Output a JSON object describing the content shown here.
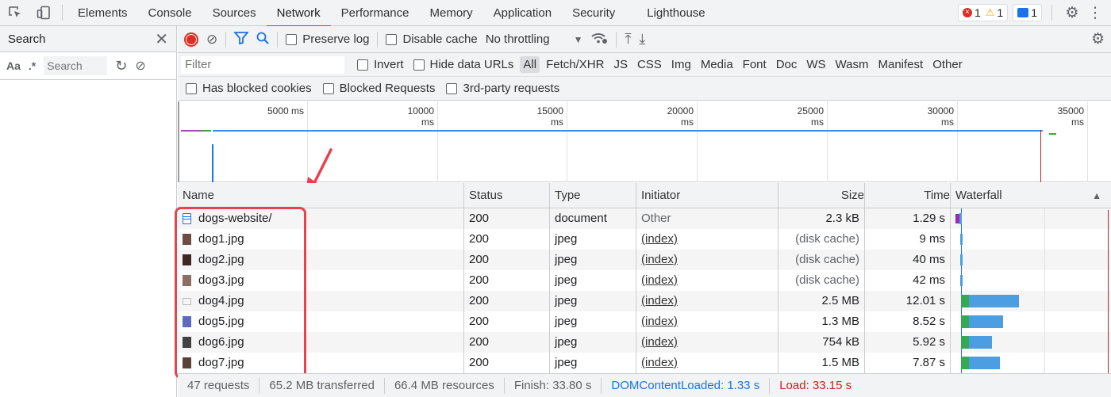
{
  "tabs": [
    "Elements",
    "Console",
    "Sources",
    "Network",
    "Performance",
    "Memory",
    "Application",
    "Security",
    "Lighthouse"
  ],
  "active_tab": "Network",
  "badges": {
    "errors": "1",
    "warnings": "1",
    "messages": "1"
  },
  "sidebar": {
    "title": "Search",
    "case_label": "Aa",
    "regex_label": ".*",
    "search_placeholder": "Search"
  },
  "toolbar": {
    "preserve_log": "Preserve log",
    "disable_cache": "Disable cache",
    "throttling": "No throttling"
  },
  "filter": {
    "placeholder": "Filter",
    "invert": "Invert",
    "hide_data_urls": "Hide data URLs",
    "types": [
      "All",
      "Fetch/XHR",
      "JS",
      "CSS",
      "Img",
      "Media",
      "Font",
      "Doc",
      "WS",
      "Wasm",
      "Manifest",
      "Other"
    ],
    "active_type": "All"
  },
  "row3": {
    "blocked_cookies": "Has blocked cookies",
    "blocked_requests": "Blocked Requests",
    "third_party": "3rd-party requests"
  },
  "overview_ticks": [
    "5000 ms",
    "10000 ms",
    "15000 ms",
    "20000 ms",
    "25000 ms",
    "30000 ms",
    "35000 ms"
  ],
  "columns": [
    "Name",
    "Status",
    "Type",
    "Initiator",
    "Size",
    "Time",
    "Waterfall"
  ],
  "rows": [
    {
      "name": "dogs-website/",
      "status": "200",
      "type": "document",
      "initiator": "Other",
      "size": "2.3 kB",
      "time": "1.29 s",
      "icon": "document-icon",
      "wf_start": 0.02,
      "wf_len": 0.015
    },
    {
      "name": "dog1.jpg",
      "status": "200",
      "type": "jpeg",
      "initiator": "(index)",
      "size": "(disk cache)",
      "time": "9 ms",
      "icon": "image-icon",
      "wf_start": 0.06,
      "wf_len": 0.01
    },
    {
      "name": "dog2.jpg",
      "status": "200",
      "type": "jpeg",
      "initiator": "(index)",
      "size": "(disk cache)",
      "time": "40 ms",
      "icon": "image-icon",
      "wf_start": 0.06,
      "wf_len": 0.01
    },
    {
      "name": "dog3.jpg",
      "status": "200",
      "type": "jpeg",
      "initiator": "(index)",
      "size": "(disk cache)",
      "time": "42 ms",
      "icon": "image-icon",
      "wf_start": 0.06,
      "wf_len": 0.01
    },
    {
      "name": "dog4.jpg",
      "status": "200",
      "type": "jpeg",
      "initiator": "(index)",
      "size": "2.5 MB",
      "time": "12.01 s",
      "icon": "image-icon",
      "wf_start": 0.065,
      "wf_len": 0.36
    },
    {
      "name": "dog5.jpg",
      "status": "200",
      "type": "jpeg",
      "initiator": "(index)",
      "size": "1.3 MB",
      "time": "8.52 s",
      "icon": "image-icon",
      "wf_start": 0.065,
      "wf_len": 0.26
    },
    {
      "name": "dog6.jpg",
      "status": "200",
      "type": "jpeg",
      "initiator": "(index)",
      "size": "754 kB",
      "time": "5.92 s",
      "icon": "image-icon",
      "wf_start": 0.065,
      "wf_len": 0.19
    },
    {
      "name": "dog7.jpg",
      "status": "200",
      "type": "jpeg",
      "initiator": "(index)",
      "size": "1.5 MB",
      "time": "7.87 s",
      "icon": "image-icon",
      "wf_start": 0.065,
      "wf_len": 0.24
    }
  ],
  "statusbar": {
    "requests": "47 requests",
    "transferred": "65.2 MB transferred",
    "resources": "66.4 MB resources",
    "finish": "Finish: 33.80 s",
    "dcl": "DOMContentLoaded: 1.33 s",
    "load": "Load: 33.15 s"
  },
  "colors": {
    "accent": "#1a73e8",
    "record": "#d93025",
    "highlight": "#e8424f",
    "dcl": "#1a73e8",
    "load": "#c5221f"
  }
}
